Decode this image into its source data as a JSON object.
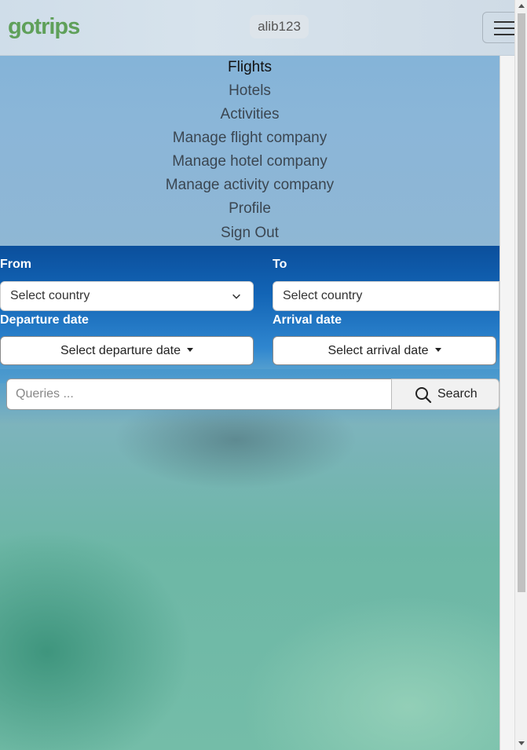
{
  "navbar": {
    "brand": "gotrips",
    "username": "alib123",
    "toggler_icon": "hamburger-icon"
  },
  "menu": {
    "items": [
      {
        "label": "Flights",
        "active": true
      },
      {
        "label": "Hotels",
        "active": false
      },
      {
        "label": "Activities",
        "active": false
      },
      {
        "label": "Manage flight company",
        "active": false
      },
      {
        "label": "Manage hotel company",
        "active": false
      },
      {
        "label": "Manage activity company",
        "active": false
      },
      {
        "label": "Profile",
        "active": false
      },
      {
        "label": "Sign Out",
        "active": false
      }
    ]
  },
  "form": {
    "from_label": "From",
    "from_select": "Select country",
    "to_label": "To",
    "to_select": "Select country",
    "departure_label": "Departure date",
    "departure_button": "Select departure date",
    "arrival_label": "Arrival date",
    "arrival_button": "Select arrival date"
  },
  "search": {
    "placeholder": "Queries ...",
    "button_label": "Search",
    "icon": "search-icon"
  },
  "colors": {
    "brand": "#5fa05a",
    "label": "#ffffff"
  }
}
